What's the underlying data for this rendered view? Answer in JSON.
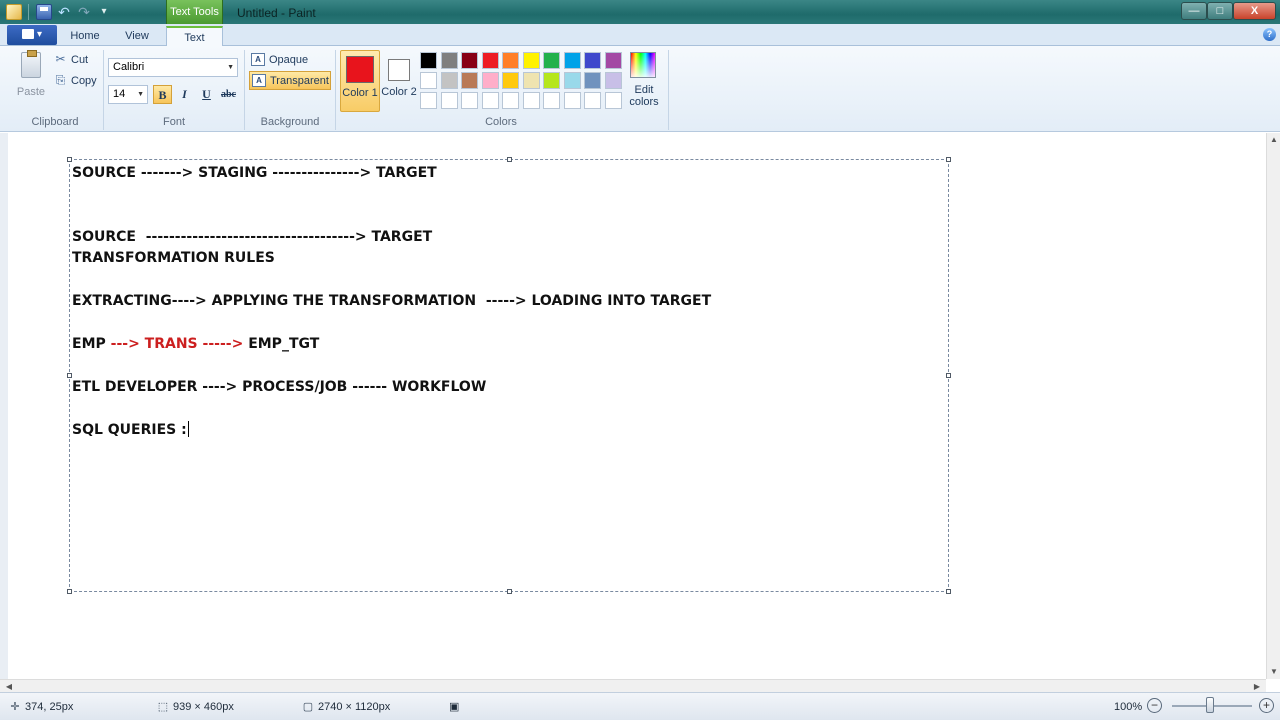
{
  "window": {
    "contextual_tab": "Text Tools",
    "title": "Untitled - Paint",
    "minimize_glyph": "—",
    "maximize_glyph": "□",
    "close_glyph": "X"
  },
  "quick_access": {
    "icons": [
      "paint-app-icon",
      "save-icon",
      "undo-icon",
      "redo-icon",
      "customize-dropdown-icon"
    ],
    "undo_glyph": "↶",
    "redo_glyph": "↷",
    "dropdown_glyph": "▾"
  },
  "tabs": {
    "menu_glyph": "▾",
    "items": [
      "Home",
      "View",
      "Text"
    ],
    "active": "Text",
    "help_glyph": "?"
  },
  "ribbon": {
    "clipboard": {
      "label": "Clipboard",
      "paste": "Paste",
      "cut": "Cut",
      "copy": "Copy",
      "cut_glyph": "✂",
      "copy_glyph": "⎘"
    },
    "font": {
      "label": "Font",
      "family": "Calibri",
      "size": "14",
      "bold": "B",
      "italic": "I",
      "underline": "U",
      "strikethrough": "abc",
      "dd_glyph": "▼"
    },
    "background": {
      "label": "Background",
      "opaque": "Opaque",
      "transparent": "Transparent",
      "icon_glyph": "A",
      "selected": "Transparent"
    },
    "colors": {
      "label": "Colors",
      "color1_label": "Color 1",
      "color2_label": "Color 2",
      "color1": "#e8141c",
      "color2": "#ffffff",
      "edit_label": "Edit colors",
      "palette": [
        [
          "#000000",
          "#7f7f7f",
          "#880015",
          "#ed1c24",
          "#ff7f27",
          "#fff200",
          "#22b14c",
          "#00a2e8",
          "#3f48cc",
          "#a349a4"
        ],
        [
          "#ffffff",
          "#c3c3c3",
          "#b97a57",
          "#ffaec9",
          "#ffc90e",
          "#efe4b0",
          "#b5e61d",
          "#99d9ea",
          "#7092be",
          "#c8bfe7"
        ],
        [
          "#ffffff",
          "#ffffff",
          "#ffffff",
          "#ffffff",
          "#ffffff",
          "#ffffff",
          "#ffffff",
          "#ffffff",
          "#ffffff",
          "#ffffff"
        ]
      ]
    }
  },
  "canvas": {
    "lines": [
      {
        "segments": [
          {
            "text": "SOURCE -------> STAGING ---------------> TARGET",
            "color": "black"
          }
        ]
      },
      {
        "segments": [
          {
            "text": "SOURCE  ------------------------------------> TARGET",
            "color": "black"
          }
        ]
      },
      {
        "segments": [
          {
            "text": "TRANSFORMATION RULES",
            "color": "black"
          }
        ]
      },
      {
        "segments": [
          {
            "text": "EXTRACTING----> APPLYING THE TRANSFORMATION  -----> LOADING INTO TARGET",
            "color": "black"
          }
        ]
      },
      {
        "segments": [
          {
            "text": "EMP ",
            "color": "black"
          },
          {
            "text": "---> TRANS -----> ",
            "color": "red"
          },
          {
            "text": "EMP_TGT",
            "color": "black"
          }
        ]
      },
      {
        "segments": [
          {
            "text": "ETL DEVELOPER ----> PROCESS/JOB ------ WORKFLOW",
            "color": "black"
          }
        ]
      },
      {
        "segments": [
          {
            "text": "SQL QUERIES :",
            "color": "black"
          }
        ]
      }
    ],
    "text_color_red": "#cc1f1f"
  },
  "scrollbars": {
    "up": "▲",
    "down": "▼",
    "left": "◀",
    "right": "▶"
  },
  "status": {
    "position": "374, 25px",
    "selection_size": "939 × 460px",
    "image_size": "2740 × 1120px",
    "zoom": "100%",
    "zoom_fraction": 0.5,
    "zoom_out": "−",
    "zoom_in": "+",
    "pos_glyph": "✛",
    "sel_glyph": "⬚",
    "img_glyph": "▢",
    "save_glyph": "▣"
  }
}
